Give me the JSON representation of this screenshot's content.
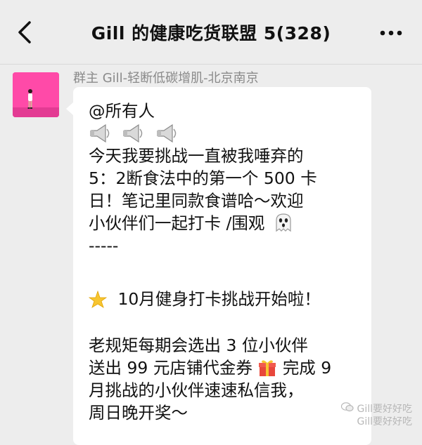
{
  "header": {
    "title": "Gill 的健康吃货联盟 5(328)",
    "back_icon": "chevron-left-icon",
    "more_icon": "more-dots-icon"
  },
  "message": {
    "sender": "群主 Gill-轻断低碳增肌-北京南京",
    "avatar_icon": "person-avatar",
    "lines": [
      "@所有人",
      "",
      "今天我要挑战一直被我唾弃的",
      "5：2断食法中的第一个 500 卡",
      "日！笔记里同款食谱哈～欢迎",
      "小伙伴们一起打卡 /围观",
      "-----",
      "",
      "10月健身打卡挑战开始啦！",
      "",
      "老规矩每期会选出 3 位小伙伴",
      "送出 99 元店铺代金券",
      "完成 9",
      "月挑战的小伙伴速速私信我，",
      "周日晚开奖～"
    ]
  },
  "watermark": {
    "line1": "Gill要好好吃",
    "line2": "Gill要好好吃"
  },
  "colors": {
    "background": "#ededed",
    "bubble": "#ffffff",
    "avatar": "#ff4aa8"
  }
}
